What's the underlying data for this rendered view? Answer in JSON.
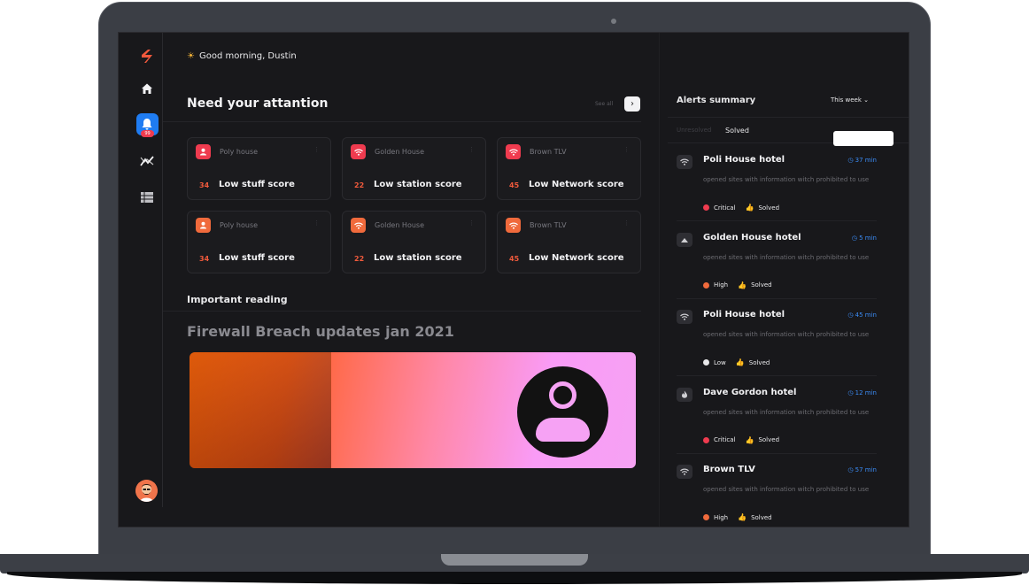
{
  "greeting": "Good morning, Dustin",
  "attention": {
    "title": "Need your attantion",
    "see_all": "See all",
    "cards": [
      {
        "name": "Poly house",
        "score": "34",
        "label": "Low stuff score",
        "icon": "user-icon",
        "color": "#ef3b4f"
      },
      {
        "name": "Golden House",
        "score": "22",
        "label": "Low station score",
        "icon": "wifi-icon",
        "color": "#ef3b4f"
      },
      {
        "name": "Brown TLV",
        "score": "45",
        "label": "Low Network score",
        "icon": "wifi-icon",
        "color": "#ef3b4f"
      },
      {
        "name": "Poly house",
        "score": "34",
        "label": "Low stuff score",
        "icon": "user-icon",
        "color": "#f06a3c"
      },
      {
        "name": "Golden House",
        "score": "22",
        "label": "Low station score",
        "icon": "wifi-icon",
        "color": "#f06a3c"
      },
      {
        "name": "Brown TLV",
        "score": "45",
        "label": "Low Network score",
        "icon": "wifi-icon",
        "color": "#f06a3c"
      }
    ]
  },
  "reading": {
    "title": "Important reading",
    "article_title": "Firewall Breach updates jan 2021"
  },
  "alerts": {
    "title": "Alerts summary",
    "period": "This week",
    "tabs": [
      "Unresolved",
      "Solved"
    ],
    "items": [
      {
        "name": "Poli House hotel",
        "time": "37 min",
        "desc": "opened sites with information witch prohibited to use",
        "severity": "Critical",
        "severity_color": "#ef3b4f",
        "status": "Solved",
        "icon": "wifi-icon"
      },
      {
        "name": "Golden House hotel",
        "time": "5 min",
        "desc": "opened sites with information witch prohibited to use",
        "severity": "High",
        "severity_color": "#f06a3c",
        "status": "Solved",
        "icon": "cloud-icon"
      },
      {
        "name": "Poli House hotel",
        "time": "45 min",
        "desc": "opened sites with information witch prohibited to use",
        "severity": "Low",
        "severity_color": "#e8e8ea",
        "status": "Solved",
        "icon": "wifi-icon"
      },
      {
        "name": "Dave Gordon hotel",
        "time": "12 min",
        "desc": "opened sites with information witch prohibited to use",
        "severity": "Critical",
        "severity_color": "#ef3b4f",
        "status": "Solved",
        "icon": "fire-icon"
      },
      {
        "name": "Brown TLV",
        "time": "57 min",
        "desc": "opened sites with information witch prohibited to use",
        "severity": "High",
        "severity_color": "#f06a3c",
        "status": "Solved",
        "icon": "wifi-icon"
      }
    ]
  },
  "sidebar": {
    "badge": "99"
  },
  "colors": {
    "accent": "#1f7cf2",
    "brand": "#f0583c",
    "background": "#18181b"
  }
}
